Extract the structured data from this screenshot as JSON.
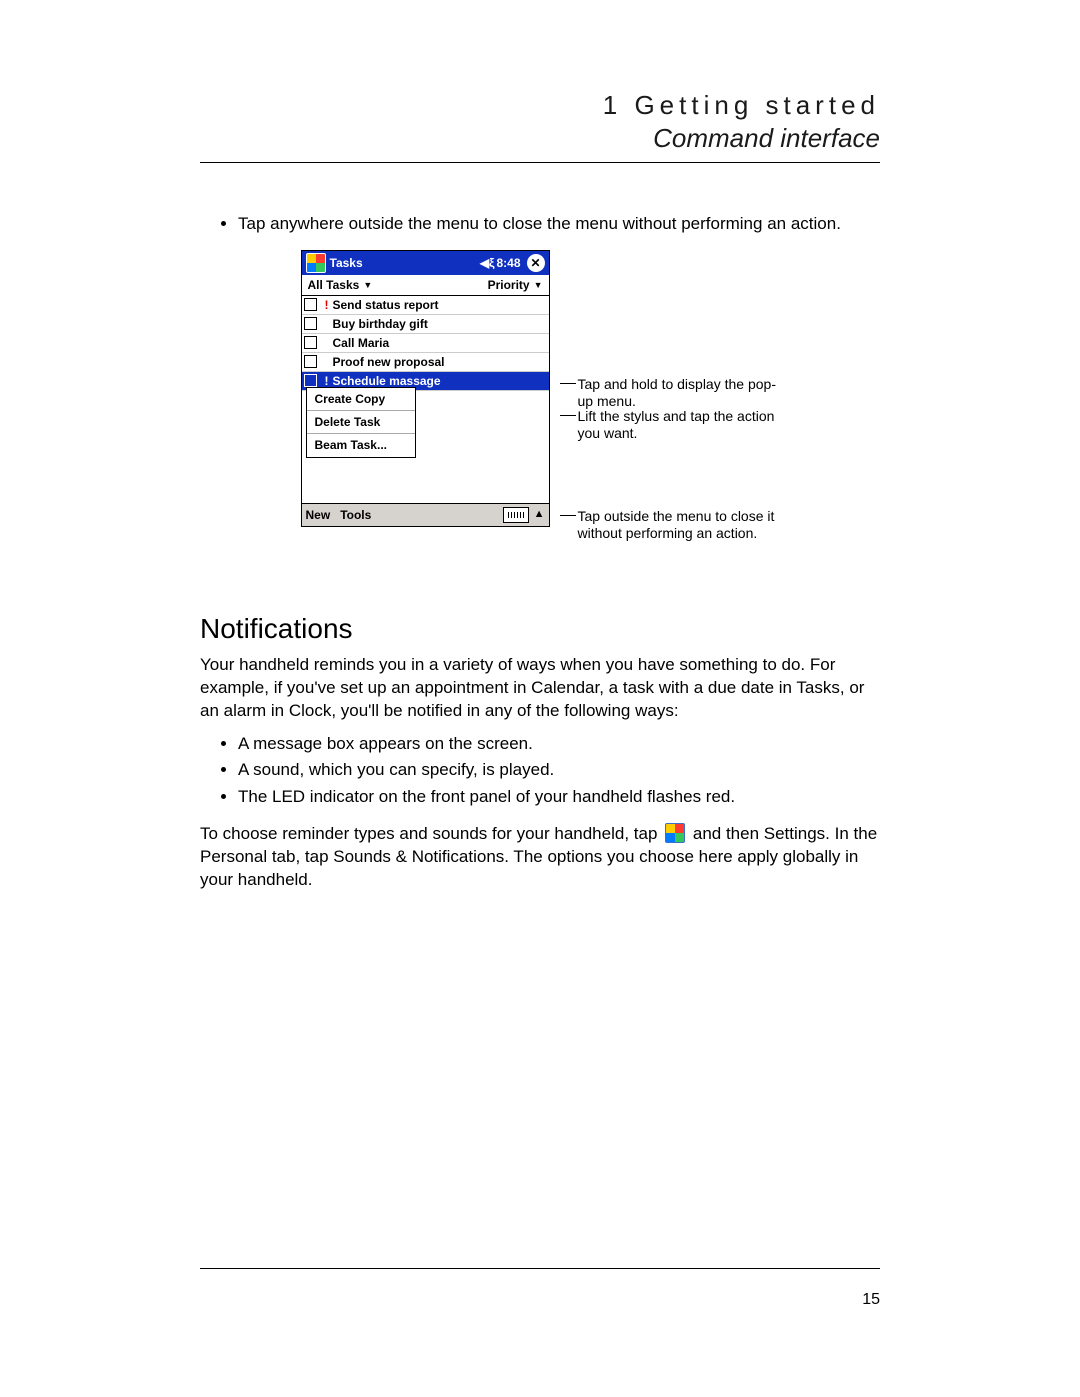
{
  "header": {
    "chapter": "1 Getting started",
    "section": "Command interface"
  },
  "pageNumber": "15",
  "intro_bullet": "Tap anywhere outside the menu to close the menu without performing an action.",
  "device": {
    "title": "Tasks",
    "time": "8:48",
    "filter_left": "All Tasks",
    "filter_right": "Priority",
    "tasks": [
      {
        "flag": true,
        "label": "Send status report"
      },
      {
        "flag": false,
        "label": "Buy birthday gift"
      },
      {
        "flag": false,
        "label": "Call Maria"
      },
      {
        "flag": false,
        "label": "Proof new proposal"
      },
      {
        "flag": true,
        "label": "Schedule massage",
        "selected": true
      }
    ],
    "popup": [
      "Create Copy",
      "Delete Task",
      "Beam Task..."
    ],
    "menu_new": "New",
    "menu_tools": "Tools"
  },
  "callouts": {
    "c1": "Tap and hold to display the pop-up menu.",
    "c2": "Lift the stylus and tap the action you want.",
    "c3": "Tap outside the menu to close it without performing an action."
  },
  "notifications": {
    "title": "Notifications",
    "intro": "Your handheld reminds you in a variety of ways when you have something to do. For example, if you've set up an appointment in Calendar, a task with a due date in Tasks, or an alarm in Clock, you'll be notified in any of the following ways:",
    "bullets": [
      "A message box appears on the screen.",
      "A sound, which you can specify, is played.",
      "The LED indicator on the front panel of your handheld flashes red."
    ],
    "outro_a": "To choose reminder types and sounds for your handheld, tap ",
    "outro_b": " and then Settings. In the Personal tab, tap Sounds & Notifications. The options you choose here apply globally in your handheld."
  }
}
